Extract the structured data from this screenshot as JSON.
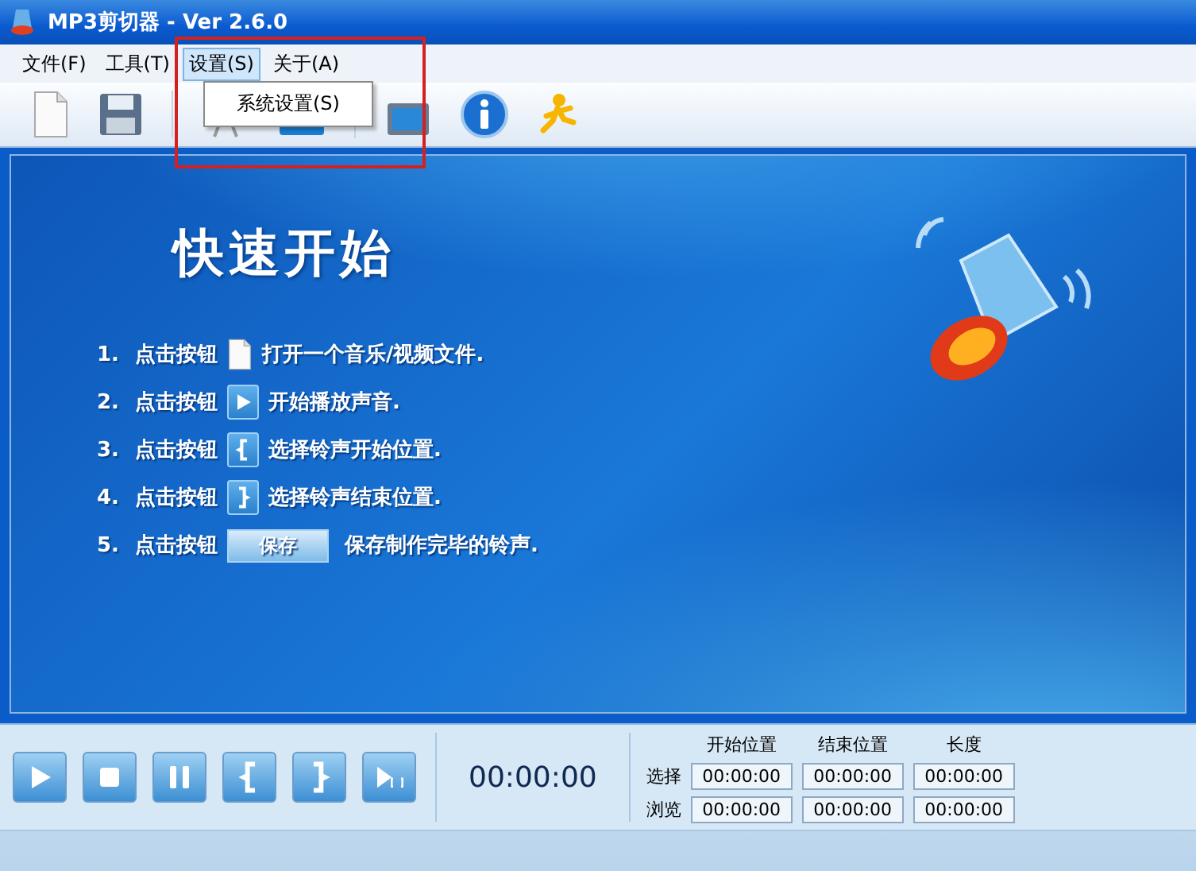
{
  "window": {
    "title": "MP3剪切器 - Ver 2.6.0"
  },
  "menu": [
    {
      "label": "文件(F)",
      "selected": false
    },
    {
      "label": "工具(T)",
      "selected": false
    },
    {
      "label": "设置(S)",
      "selected": true
    },
    {
      "label": "关于(A)",
      "selected": false
    }
  ],
  "dropdown": {
    "items": [
      "系统设置(S)"
    ]
  },
  "quick_start": {
    "heading": "快速开始",
    "steps": [
      {
        "number": "1.",
        "prefix": "点击按钮",
        "kind": "open-file",
        "text": "打开一个音乐/视频文件."
      },
      {
        "number": "2.",
        "prefix": "点击按钮",
        "kind": "play",
        "text": "开始播放声音."
      },
      {
        "number": "3.",
        "prefix": "点击按钮",
        "kind": "mark-start",
        "text": "选择铃声开始位置."
      },
      {
        "number": "4.",
        "prefix": "点击按钮",
        "kind": "mark-end",
        "text": "选择铃声结束位置."
      },
      {
        "number": "5.",
        "prefix": "点击按钮",
        "kind": "save",
        "button_label": "保存",
        "text": "保存制作完毕的铃声."
      }
    ]
  },
  "controls": {
    "time": "00:00:00",
    "columns": [
      "开始位置",
      "结束位置",
      "长度"
    ],
    "rows": [
      {
        "label": "选择",
        "values": [
          "00:00:00",
          "00:00:00",
          "00:00:00"
        ]
      },
      {
        "label": "浏览",
        "values": [
          "00:00:00",
          "00:00:00",
          "00:00:00"
        ]
      }
    ]
  }
}
